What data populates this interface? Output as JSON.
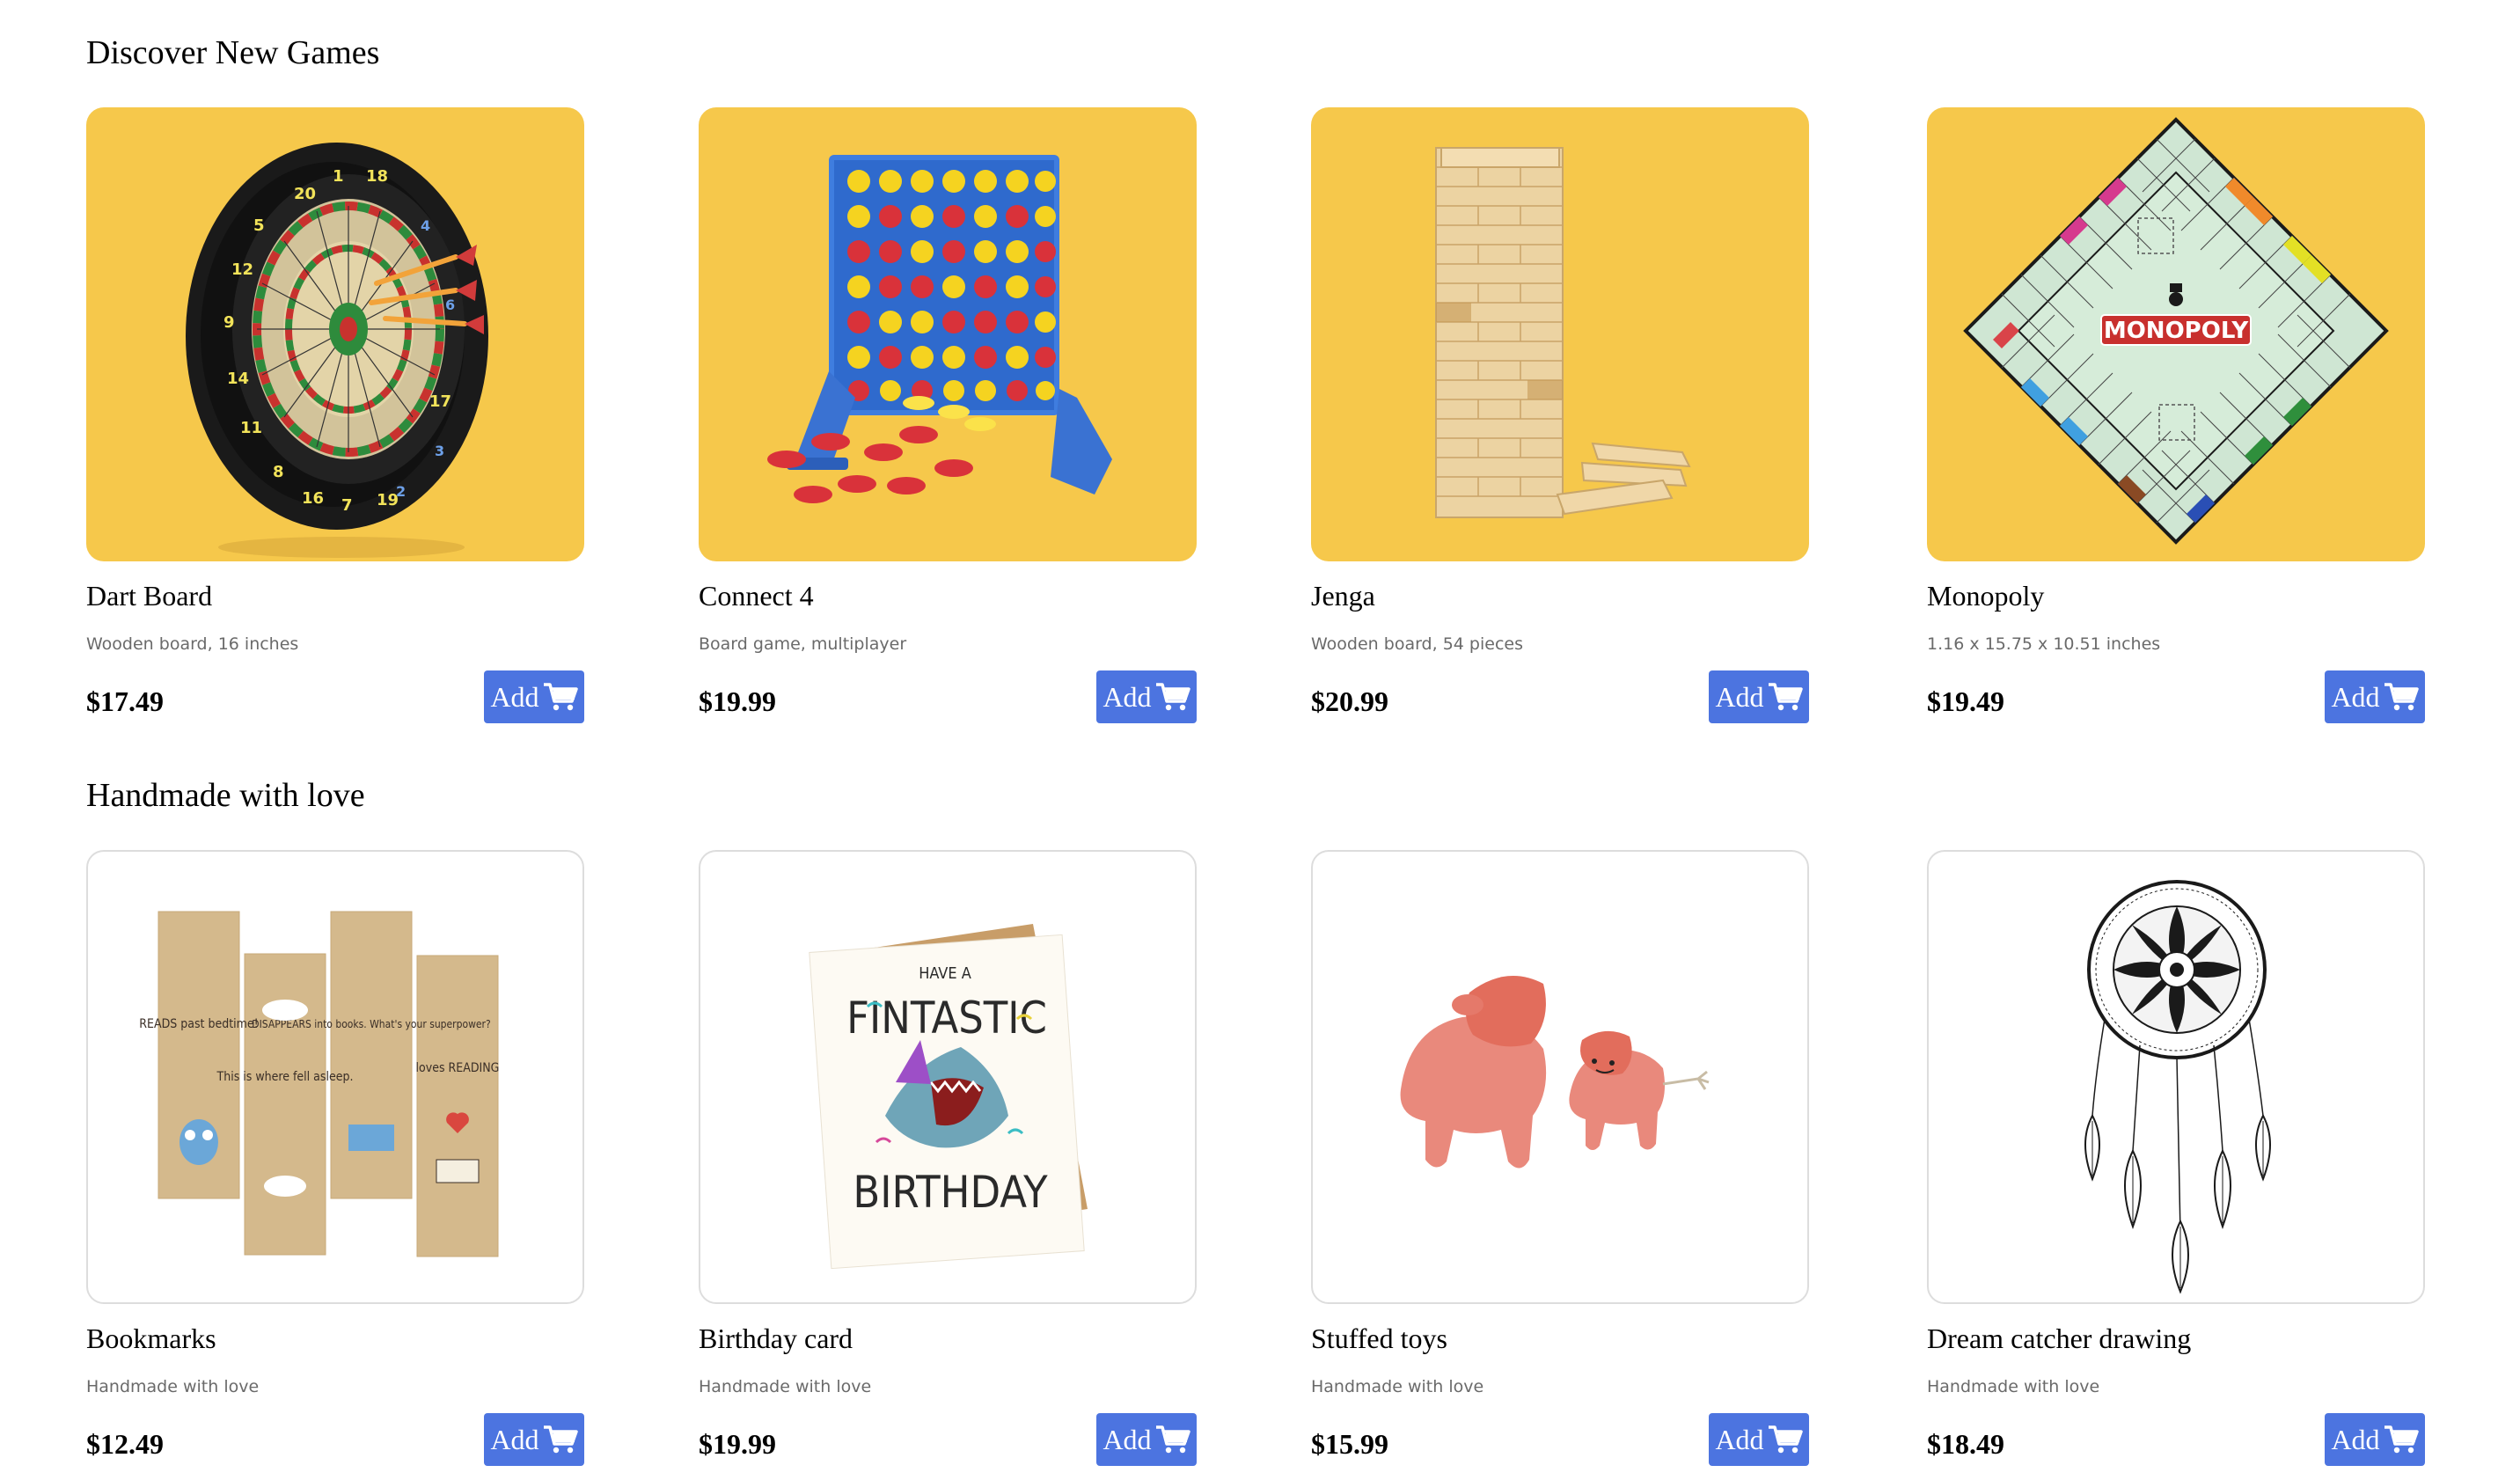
{
  "sections": [
    {
      "title": "Discover New Games",
      "products": [
        {
          "name": "Dart Board",
          "description": "Wooden board, 16 inches",
          "price": "$17.49",
          "button": "Add",
          "image": "dart-board-image",
          "background": "#f6c84b"
        },
        {
          "name": "Connect 4",
          "description": "Board game, multiplayer",
          "price": "$19.99",
          "button": "Add",
          "image": "connect-4-image",
          "background": "#f6c84b"
        },
        {
          "name": "Jenga",
          "description": "Wooden board, 54 pieces",
          "price": "$20.99",
          "button": "Add",
          "image": "jenga-image",
          "background": "#f6c84b"
        },
        {
          "name": "Monopoly",
          "description": "1.16 x 15.75 x 10.51 inches",
          "price": "$19.49",
          "button": "Add",
          "image": "monopoly-board-image",
          "image_text": "MONOPOLY",
          "background": "#f6c84b"
        }
      ]
    },
    {
      "title": "Handmade with love",
      "products": [
        {
          "name": "Bookmarks",
          "description": "Handmade with love",
          "price": "$12.49",
          "button": "Add",
          "image": "bookmarks-image",
          "image_text": [
            "READS past bedtime!",
            "This is where fell asleep.",
            "DISAPPEARS into books. What's your superpower?",
            "loves READING"
          ],
          "background": "#ffffff"
        },
        {
          "name": "Birthday card",
          "description": "Handmade with love",
          "price": "$19.99",
          "button": "Add",
          "image": "birthday-card-image",
          "image_text": [
            "HAVE A",
            "FINTASTIC",
            "BIRTHDAY"
          ],
          "background": "#ffffff"
        },
        {
          "name": "Stuffed toys",
          "description": "Handmade with love",
          "price": "$15.99",
          "button": "Add",
          "image": "stuffed-toys-image",
          "background": "#ffffff"
        },
        {
          "name": "Dream catcher drawing",
          "description": "Handmade with love",
          "price": "$18.49",
          "button": "Add",
          "image": "dream-catcher-image",
          "background": "#ffffff"
        }
      ]
    }
  ],
  "colors": {
    "button": "#4c74e0",
    "card_yellow": "#f6c84b",
    "description_text": "#6a6a6a"
  },
  "icons": {
    "add_button": "cart-icon"
  }
}
